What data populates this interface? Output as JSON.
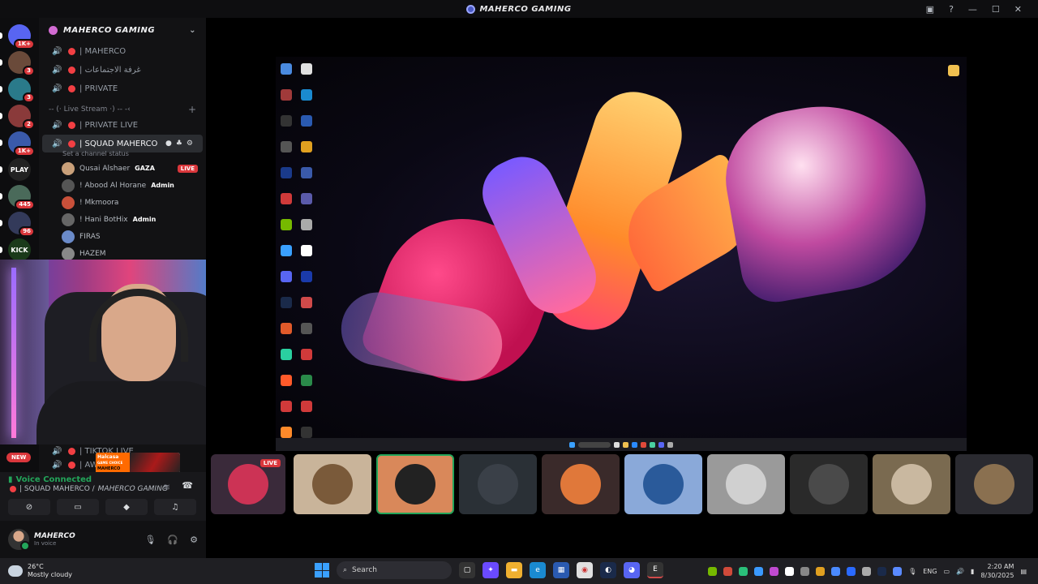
{
  "window": {
    "title": "MAHERCO GAMING"
  },
  "servers": [
    {
      "label": "",
      "badge": "1K+",
      "color": "#5865f2"
    },
    {
      "label": "",
      "badge": "3",
      "color": "#6a4a3a"
    },
    {
      "label": "",
      "badge": "3",
      "color": "#2a7a8a"
    },
    {
      "label": "",
      "badge": "2",
      "color": "#8a3a3a"
    },
    {
      "label": "",
      "badge": "1K+",
      "color": "#3a5aaa"
    },
    {
      "label": "PLAY",
      "badge": "",
      "color": "#222"
    },
    {
      "label": "",
      "badge": "445",
      "color": "#4a6a5a"
    },
    {
      "label": "",
      "badge": "96",
      "color": "#333a5a"
    },
    {
      "label": "KICK",
      "badge": "",
      "color": "#1a3a1a"
    }
  ],
  "guild": {
    "name": "MAHERCO GAMING"
  },
  "channels": [
    {
      "name": "| MAHERCO"
    },
    {
      "name": "| غرفة الاجتماعات"
    },
    {
      "name": "| PRIVATE"
    }
  ],
  "category": {
    "name": "-- (· Live Stream ·) -- -‹"
  },
  "channels_b": [
    {
      "name": "| PRIVATE LIVE"
    }
  ],
  "active_channel": {
    "name": "| SQUAD MAHERCO",
    "status": "Set a channel status"
  },
  "voice_users": [
    {
      "name": "Qusai Alshaer",
      "tag": "GAZA",
      "live": "LIVE",
      "color": "#c9a07a"
    },
    {
      "name": "! Abood Al Horane",
      "tag": "Admin",
      "live": "",
      "color": "#555"
    },
    {
      "name": "! Mkmoora",
      "tag": "",
      "live": "",
      "color": "#c9503a"
    },
    {
      "name": "! Hani BotHix",
      "tag": "Admin",
      "live": "",
      "color": "#666"
    },
    {
      "name": "FIRAS",
      "tag": "",
      "live": "",
      "color": "#6a8ac9"
    },
    {
      "name": "HAZEM",
      "tag": "",
      "live": "",
      "color": "#888"
    }
  ],
  "lower_channels": [
    {
      "name": "| TIKTOK LIVE"
    },
    {
      "name": "| AWS"
    }
  ],
  "new_badge": "NEW",
  "promo": {
    "brand": "Halcasa",
    "tagline": "GAME CHOICE",
    "name": "MAHERCO"
  },
  "voice": {
    "status": "Voice Connected",
    "location_channel": "| SQUAD MAHERCO /",
    "location_server": "MAHERCO GAMING"
  },
  "user": {
    "name": "MAHERCO",
    "status": "In voice"
  },
  "tiles": [
    {
      "live": "LIVE",
      "color": "#3a2a3a",
      "face": "#cc3355"
    },
    {
      "live": "",
      "color": "#c9b49a",
      "face": "#7a5a3a"
    },
    {
      "live": "",
      "color": "#d9885a",
      "face": "#222"
    },
    {
      "live": "",
      "color": "#2a3036",
      "face": "#3a4048"
    },
    {
      "live": "",
      "color": "#3a2a2a",
      "face": "#e0783a"
    },
    {
      "live": "",
      "color": "#8aa9d9",
      "face": "#2a5a9a"
    },
    {
      "live": "",
      "color": "#9a9a9a",
      "face": "#d0d0d0"
    },
    {
      "live": "",
      "color": "#2a2a2a",
      "face": "#4a4a4a"
    },
    {
      "live": "",
      "color": "#7a6a50",
      "face": "#c9b8a0"
    },
    {
      "live": "",
      "color": "#2a2a30",
      "face": "#8a7050"
    }
  ],
  "weather": {
    "temp": "26°C",
    "desc": "Mostly cloudy"
  },
  "taskbar": {
    "search_placeholder": "Search",
    "lang": "ENG",
    "time": "2:20 AM",
    "date": "8/30/2025"
  }
}
